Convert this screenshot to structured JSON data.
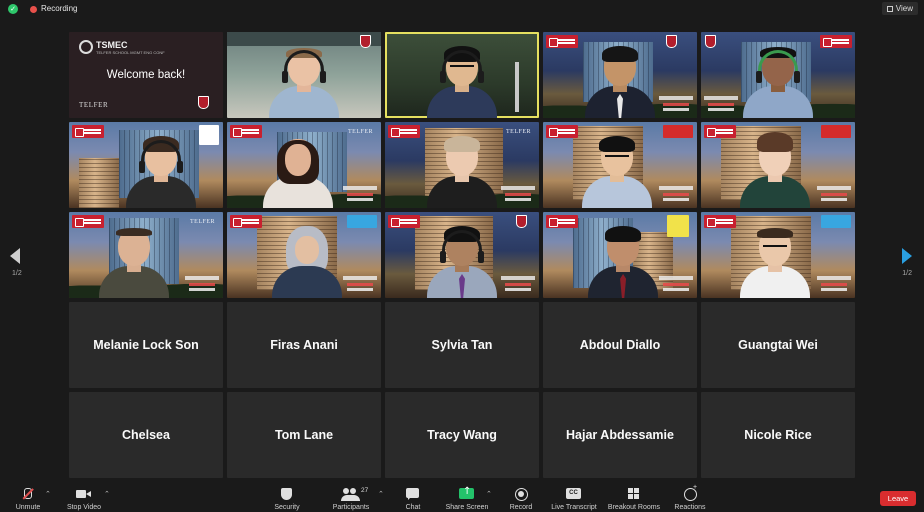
{
  "topbar": {
    "recording_label": "Recording",
    "view_label": "View"
  },
  "pagination": {
    "left": "1/2",
    "right": "1/2"
  },
  "welcome_tile": {
    "brand": "TSMEC",
    "brand_sub": "TELFER SCHOOL MGMT ENG CONF",
    "message": "Welcome back!",
    "school": "TELFER"
  },
  "name_tiles": [
    "Melanie Lock Son",
    "Firas Anani",
    "Sylvia Tan",
    "Abdoul Diallo",
    "Guangtai Wei",
    "Chelsea",
    "Tom Lane",
    "Tracy Wang",
    "Hajar Abdessamie",
    "Nicole Rice"
  ],
  "colors": {
    "active_speaker_outline": "#e5e060",
    "leave": "#d92d2f",
    "share_screen": "#23c26a",
    "brand_red": "#c8202f",
    "nav_next": "#2a9fe0"
  },
  "toolbar": {
    "unmute": "Unmute",
    "stop_video": "Stop Video",
    "security": "Security",
    "participants": "Participants",
    "participants_count": "27",
    "chat": "Chat",
    "share_screen": "Share Screen",
    "record": "Record",
    "live_transcript": "Live Transcript",
    "breakout_rooms": "Breakout Rooms",
    "reactions": "Reactions",
    "leave": "Leave"
  },
  "icons": {
    "encryption": "shield-check-icon",
    "recording": "record-dot-icon",
    "view": "grid-view-icon",
    "unmute": "mic-muted-icon",
    "stop_video": "camera-icon",
    "security": "shield-icon",
    "participants": "people-icon",
    "chat": "chat-bubble-icon",
    "share_screen": "share-screen-icon",
    "record": "record-icon",
    "live_transcript": "closed-caption-icon",
    "breakout_rooms": "breakout-rooms-icon",
    "reactions": "reaction-emoji-icon"
  }
}
